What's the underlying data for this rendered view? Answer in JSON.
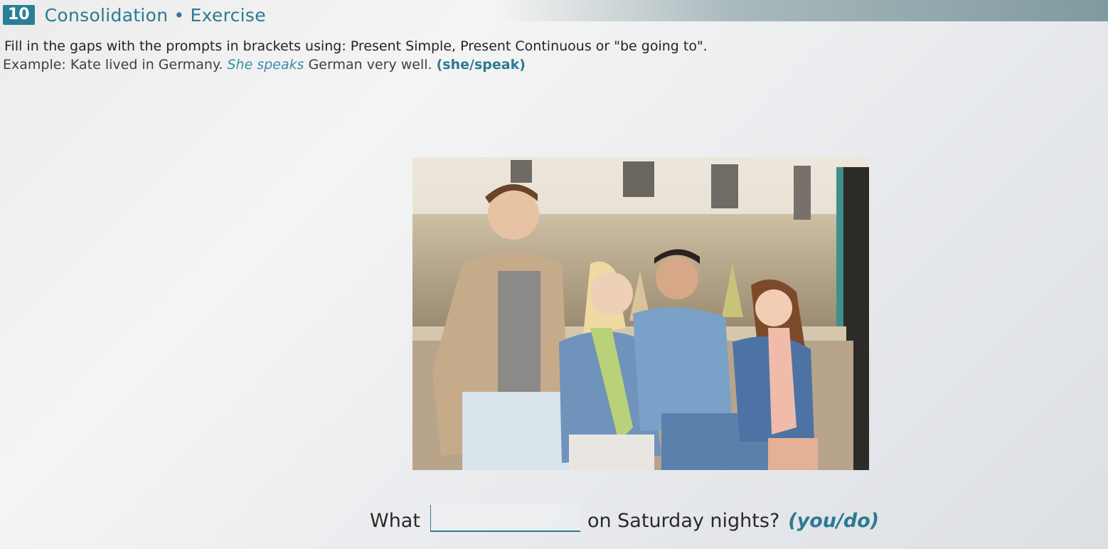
{
  "header": {
    "number": "10",
    "section": "Consolidation",
    "separator": "•",
    "subsection": "Exercise"
  },
  "instructions": "Fill in the gaps with the prompts in brackets using: Present Simple, Present Continuous or \"be going to\".",
  "example": {
    "label": "Example:",
    "before": "Kate lived in Germany.",
    "answer": "She speaks",
    "after": "German very well.",
    "prompt": "(she/speak)"
  },
  "question": {
    "before": "What",
    "answer_value": "",
    "after": "on Saturday nights?",
    "prompt": "(you/do)"
  },
  "colors": {
    "accent": "#2b7b92",
    "badge": "#2a7f96",
    "answer_text": "#3a8ea9"
  }
}
